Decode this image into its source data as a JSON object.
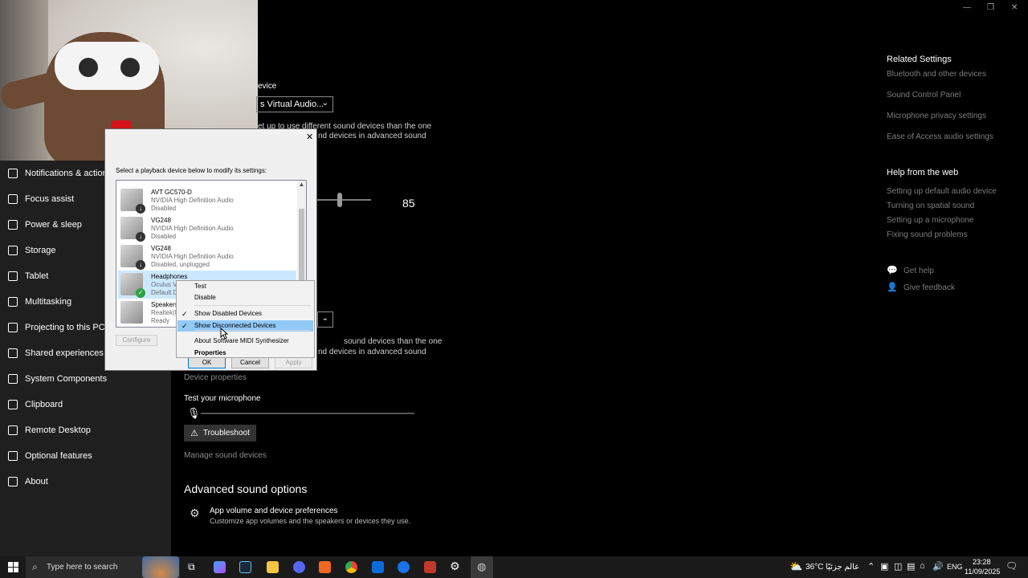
{
  "window": {
    "minimize": "—",
    "restore": "❐",
    "close": "✕"
  },
  "sidebar": {
    "items": [
      {
        "label": "Notifications & actions",
        "icon": "notifications-icon"
      },
      {
        "label": "Focus assist",
        "icon": "moon-icon"
      },
      {
        "label": "Power & sleep",
        "icon": "power-icon"
      },
      {
        "label": "Storage",
        "icon": "storage-icon"
      },
      {
        "label": "Tablet",
        "icon": "tablet-icon"
      },
      {
        "label": "Multitasking",
        "icon": "multitasking-icon"
      },
      {
        "label": "Projecting to this PC",
        "icon": "projecting-icon"
      },
      {
        "label": "Shared experiences",
        "icon": "shared-icon"
      },
      {
        "label": "System Components",
        "icon": "components-icon"
      },
      {
        "label": "Clipboard",
        "icon": "clipboard-icon"
      },
      {
        "label": "Remote Desktop",
        "icon": "remote-desktop-icon"
      },
      {
        "label": "Optional features",
        "icon": "optional-features-icon"
      },
      {
        "label": "About",
        "icon": "about-icon"
      }
    ]
  },
  "main": {
    "output_heading_fragment": "evice",
    "output_device_value": "s Virtual Audio...",
    "output_desc_line1": "et up to use different sound devices than the one",
    "output_desc_line2": "nd devices in advanced sound",
    "volume_value": "85",
    "volume_level": 0.85,
    "input_desc_line1": "sound devices than the one",
    "input_desc_line2": "nd devices in advanced sound",
    "device_properties": "Device properties",
    "test_mic_label": "Test your microphone",
    "troubleshoot_label": "Troubleshoot",
    "manage_devices": "Manage sound devices",
    "advanced_heading": "Advanced sound options",
    "app_volume_title": "App volume and device preferences",
    "app_volume_desc": "Customize app volumes and the speakers or devices they use."
  },
  "right": {
    "related_heading": "Related Settings",
    "related_links": [
      "Bluetooth and other devices",
      "Sound Control Panel",
      "Microphone privacy settings",
      "Ease of Access audio settings"
    ],
    "help_heading": "Help from the web",
    "help_links": [
      "Setting up default audio device",
      "Turning on spatial sound",
      "Setting up a microphone",
      "Fixing sound problems"
    ],
    "get_help": "Get help",
    "give_feedback": "Give feedback"
  },
  "dialog": {
    "close": "✕",
    "instruction": "Select a playback device below to modify its settings:",
    "devices": [
      {
        "name": "AVT GC570-D",
        "driver": "NVIDIA High Definition Audio",
        "status": "Disabled",
        "badge": "down"
      },
      {
        "name": "VG248",
        "driver": "NVIDIA High Definition Audio",
        "status": "Disabled",
        "badge": "down"
      },
      {
        "name": "VG248",
        "driver": "NVIDIA High Definition Audio",
        "status": "Disabled, unplugged",
        "badge": "down"
      },
      {
        "name": "Headphones",
        "driver": "Oculus V",
        "status": "Default D",
        "badge": "default"
      },
      {
        "name": "Speakers",
        "driver": "Realtek(R",
        "status": "Ready",
        "badge": "none"
      }
    ],
    "configure": "Configure",
    "ok": "OK",
    "cancel": "Cancel",
    "apply": "Apply"
  },
  "context_menu": {
    "items": [
      {
        "label": "Test",
        "checked": false
      },
      {
        "label": "Disable",
        "checked": false
      },
      {
        "label": "Show Disabled Devices",
        "checked": true
      },
      {
        "label": "Show Disconnected Devices",
        "checked": true
      },
      {
        "label": "About Software MIDI Synthesizer",
        "checked": false
      },
      {
        "label": "Properties",
        "checked": false
      }
    ]
  },
  "taskbar": {
    "search_placeholder": "Type here to search",
    "weather": "36°C",
    "weather_location": "عالم جزئيًا",
    "language": "ENG",
    "time": "23:28",
    "date": "11/09/2025"
  }
}
